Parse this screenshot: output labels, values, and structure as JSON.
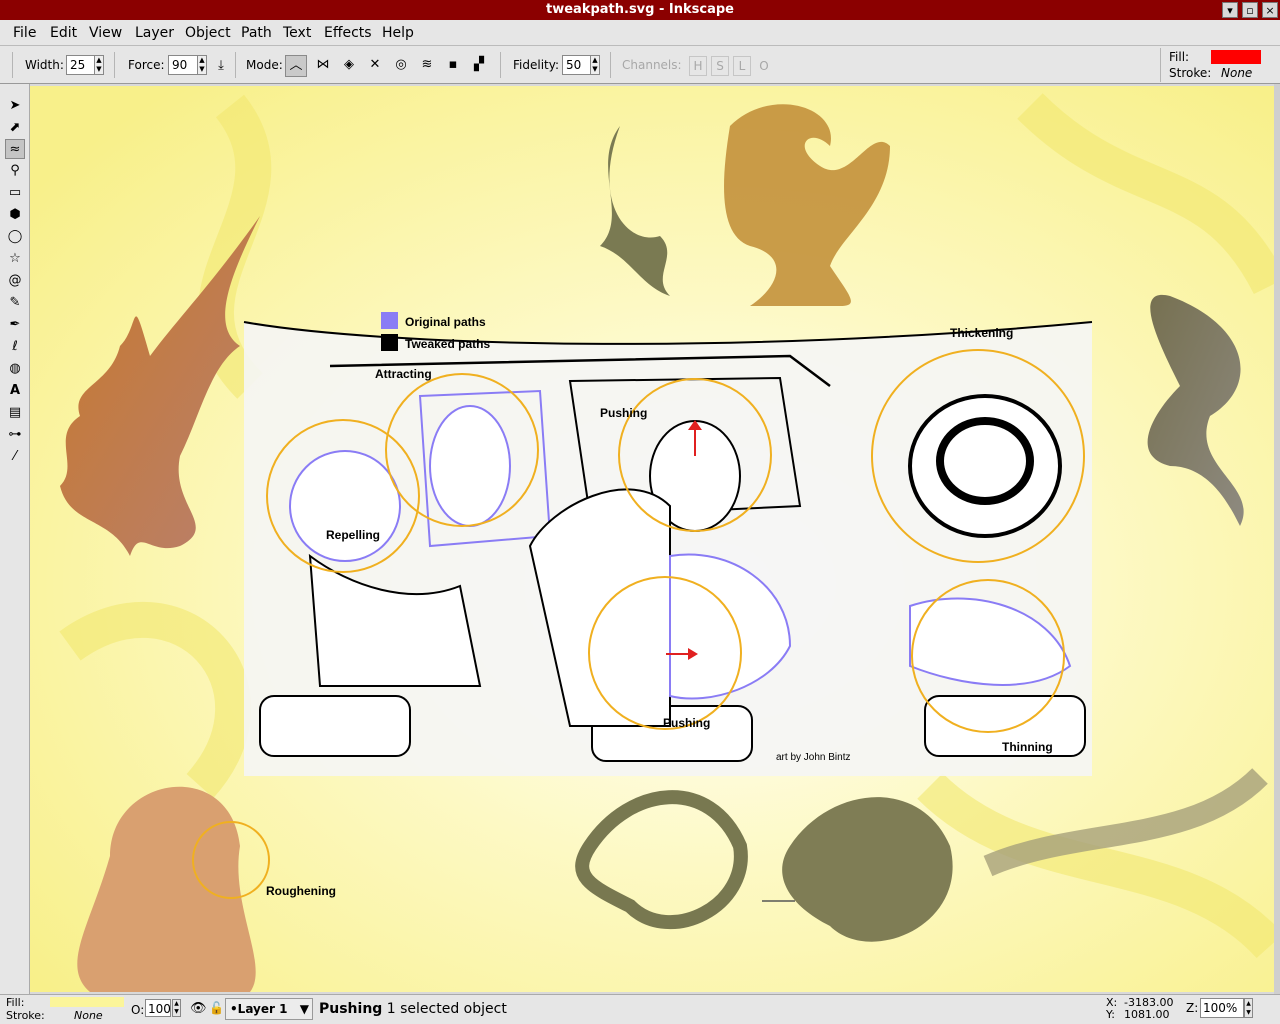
{
  "window": {
    "title": "tweakpath.svg - Inkscape"
  },
  "menu": [
    "File",
    "Edit",
    "View",
    "Layer",
    "Object",
    "Path",
    "Text",
    "Effects",
    "Help"
  ],
  "toolbar": {
    "width_label": "Width:",
    "width_value": "25",
    "force_label": "Force:",
    "force_value": "90",
    "mode_label": "Mode:",
    "fidelity_label": "Fidelity:",
    "fidelity_value": "50",
    "channels_label": "Channels:",
    "channels": [
      "H",
      "S",
      "L",
      "O"
    ],
    "fill_label": "Fill:",
    "stroke_label": "Stroke:",
    "stroke_value": "None",
    "fill_color": "#ff0000"
  },
  "canvas": {
    "legend_original": "Original paths",
    "legend_tweaked": "Tweaked paths",
    "labels": {
      "attracting": "Attracting",
      "pushing_top": "Pushing",
      "thickening": "Thickening",
      "repelling": "Repelling",
      "pushing_bottom": "Pushing",
      "thinning": "Thinning",
      "roughening": "Roughening",
      "credit": "art by John Bintz"
    },
    "colors": {
      "original": "#8a7cf5",
      "tweaked": "#000000",
      "brush": "#f0b020",
      "background": "#fbf59a"
    }
  },
  "status": {
    "fill_label": "Fill:",
    "stroke_label": "Stroke:",
    "stroke_value": "None",
    "opacity_label": "O:",
    "opacity_value": "100",
    "layer": "•Layer 1",
    "message_bold": "Pushing",
    "message": " 1 selected object",
    "x_label": "X:",
    "x_value": "-3183.00",
    "y_label": "Y:",
    "y_value": "1081.00",
    "zoom_label": "Z:",
    "zoom_value": "100%",
    "fill_color": "#fbf59a"
  }
}
